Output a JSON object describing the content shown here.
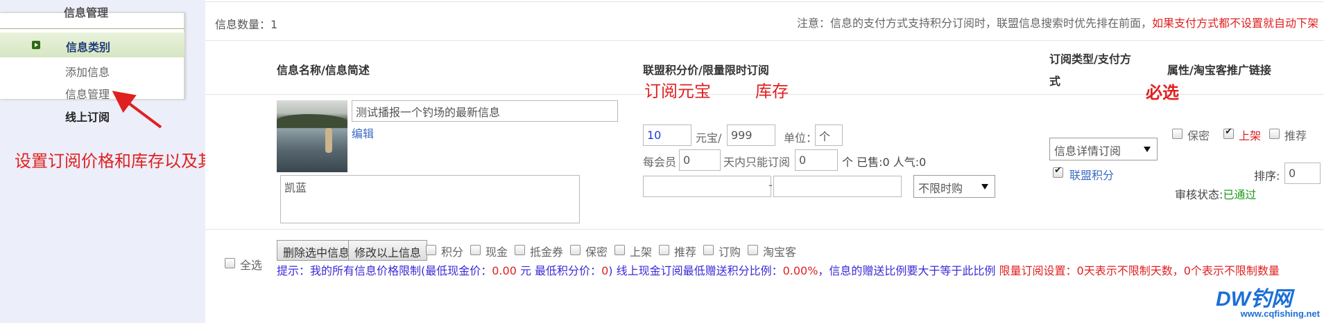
{
  "sidebar": {
    "top_item": "信息管理",
    "category": "信息类别",
    "items": [
      "添加信息",
      "信息管理"
    ],
    "online": "线上订阅",
    "annotation": "设置订阅价格和库存以及其他"
  },
  "header": {
    "info_count_label": "信息数量：",
    "info_count": "1",
    "notice_gray": "注意：信息的支付方式支持积分订阅时，联盟信息搜索时优先排在前面，",
    "notice_red": "如果支付方式都不设置就自动下架"
  },
  "columns": {
    "name": "信息名称/信息简述",
    "price": "联盟积分价/限量限时订阅",
    "type_line1": "订阅类型/支付方",
    "type_line2": "式",
    "attr": "属性/淘宝客推广链接"
  },
  "row": {
    "title_value": "测试播报一个钓场的最新信息",
    "edit_link": "编辑",
    "desc_value": "凯蓝",
    "price_value": "10",
    "price_unit": "元宝/",
    "stock_value": "999",
    "unit_label": "单位：",
    "unit_value": "个",
    "per_member": "每会员",
    "per_member_value": "0",
    "days_label": "天内只能订阅",
    "days_value": "0",
    "sold_label": "个 已售:0 人气:0",
    "date_dash": "-",
    "time_select": "不限时购",
    "sub_type": "信息详情订阅",
    "alliance_points": "联盟积分",
    "attr_secret": "保密",
    "attr_shelf": "上架",
    "attr_recommend": "推荐",
    "sort_label": "排序:",
    "sort_value": "0",
    "audit_label": "审核状态:",
    "audit_value": "已通过"
  },
  "annotations": {
    "price": "订阅元宝",
    "stock": "库存",
    "required": "必选"
  },
  "footer": {
    "select_all": "全选",
    "delete_button": "删除选中信息",
    "modify_button": "修改以上信息",
    "filters": [
      "积分",
      "现金",
      "抵金券",
      "保密",
      "上架",
      "推荐",
      "订购",
      "淘宝客"
    ],
    "tip_a": "提示：我的所有信息价格限制(最低现金价：",
    "tip_cash": "0.00",
    "tip_b": " 元 最低积分价：",
    "tip_points": "0",
    "tip_c": ") 线上现金订阅最低赠送积分比例：",
    "tip_ratio": "0.00%",
    "tip_d": "，信息的赠送比例要大于等于此比例 ",
    "tip_limit": "限量订阅设置：0天表示不限制天数，0个表示不限制数量"
  },
  "watermark": {
    "logo": "DW钓网",
    "url": "www.cqfishing.net"
  },
  "colors": {
    "annotation_red": "#e02020",
    "tip_blue": "#3a2ad6",
    "link_blue": "#3a6bc4",
    "approved_green": "#1c9a1c"
  }
}
